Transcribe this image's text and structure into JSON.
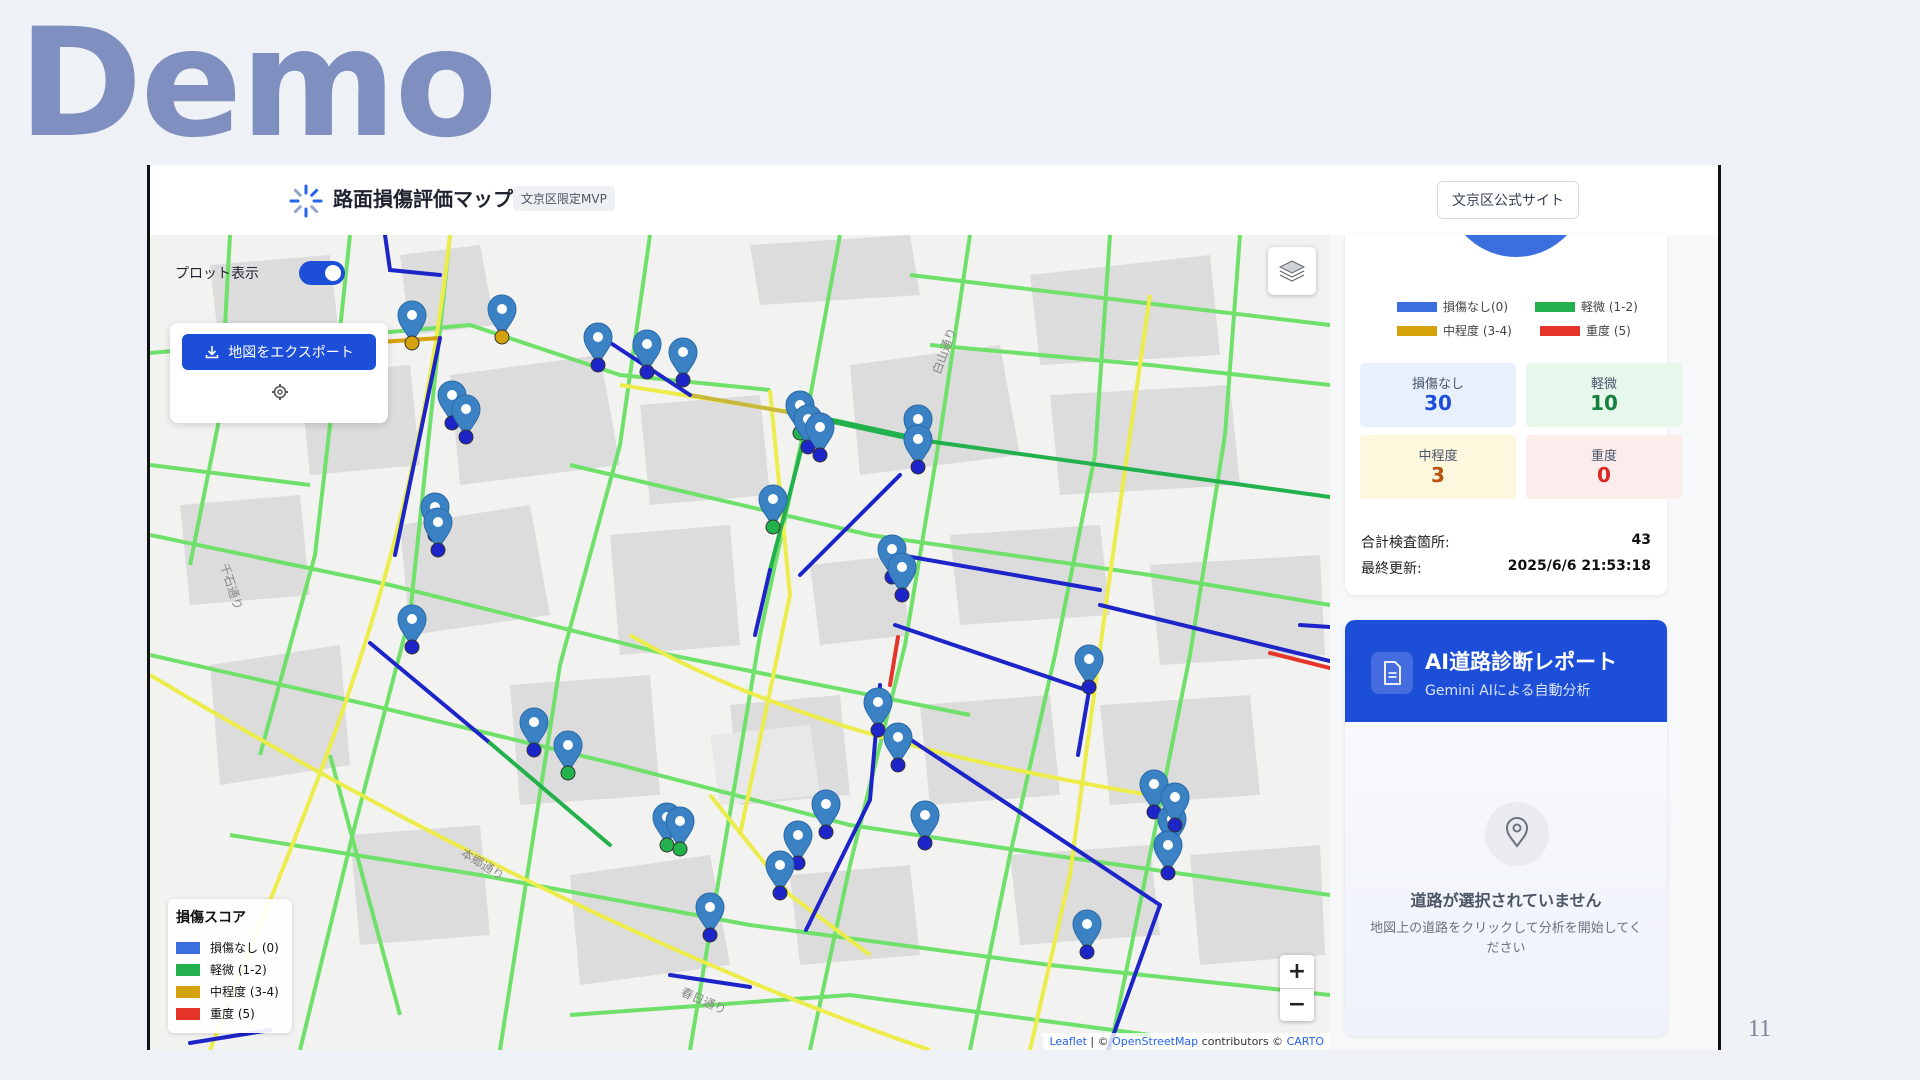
{
  "slide": {
    "title": "Demo",
    "page_number": "11"
  },
  "app": {
    "title": "路面損傷評価マップ",
    "badge": "文京区限定MVP",
    "official_site_label": "文京区公式サイト"
  },
  "map_controls": {
    "plot_toggle_label": "プロット表示",
    "plot_toggle_on": true,
    "export_label": "地図をエクスポート",
    "zoom_in": "+",
    "zoom_out": "−",
    "attribution": {
      "leaflet": "Leaflet",
      "sep1": " | © ",
      "osm": "OpenStreetMap",
      "mid": " contributors © ",
      "carto": "CARTO"
    }
  },
  "legend": {
    "title": "損傷スコア",
    "items": [
      {
        "label": "損傷なし (0)",
        "color": "#3b6fe0"
      },
      {
        "label": "軽微 (1-2)",
        "color": "#22b14c"
      },
      {
        "label": "中程度 (3-4)",
        "color": "#d4a20a"
      },
      {
        "label": "重度 (5)",
        "color": "#e5352b"
      }
    ]
  },
  "chart_data": {
    "type": "pie",
    "labels": [
      "損傷なし(0)",
      "軽微 (1-2)",
      "中程度 (3-4)",
      "重度 (5)"
    ],
    "values": [
      30,
      10,
      3,
      0
    ],
    "colors": [
      "#3b6fe0",
      "#22b14c",
      "#d4a20a",
      "#e5352b"
    ]
  },
  "stats": {
    "none": {
      "label": "損傷なし",
      "value": "30"
    },
    "minor": {
      "label": "軽微",
      "value": "10"
    },
    "moderate": {
      "label": "中程度",
      "value": "3"
    },
    "severe": {
      "label": "重度",
      "value": "0"
    },
    "total_label": "合計検査箇所:",
    "total_value": "43",
    "updated_label": "最終更新:",
    "updated_value": "2025/6/6 21:53:18"
  },
  "ai_report": {
    "title": "AI道路診断レポート",
    "subtitle": "Gemini AIによる自動分析",
    "empty_title": "道路が選択されていません",
    "empty_desc": "地図上の道路をクリックして分析を開始してください"
  },
  "map_labels": [
    "千石通り",
    "本郷通り",
    "春日通り",
    "白山通り"
  ],
  "colors": {
    "accent": "#1d4ed8",
    "none": "#1d24c8",
    "minor": "#22b14c",
    "moderate": "#d4a20a",
    "severe": "#e5352b",
    "marker": "#3b82c4"
  }
}
